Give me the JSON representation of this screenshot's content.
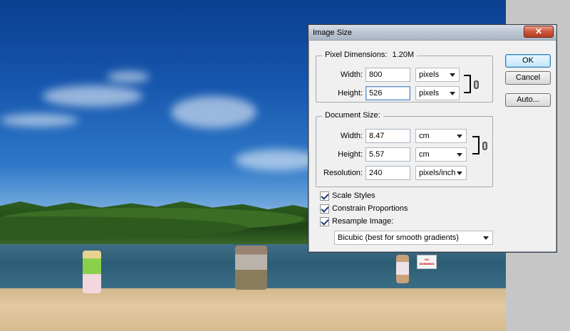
{
  "dialog": {
    "title": "Image Size",
    "close_glyph": "✕",
    "pixel_dimensions": {
      "label": "Pixel Dimensions:",
      "size": "1.20M",
      "width_label": "Width:",
      "width_value": "800",
      "width_unit": "pixels",
      "height_label": "Height:",
      "height_value": "526",
      "height_unit": "pixels"
    },
    "document_size": {
      "label": "Document Size:",
      "width_label": "Width:",
      "width_value": "8.47",
      "width_unit": "cm",
      "height_label": "Height:",
      "height_value": "5.57",
      "height_unit": "cm",
      "resolution_label": "Resolution:",
      "resolution_value": "240",
      "resolution_unit": "pixels/inch"
    },
    "options": {
      "scale_styles": "Scale Styles",
      "constrain_proportions": "Constrain Proportions",
      "resample_image": "Resample Image:",
      "resample_method": "Bicubic (best for smooth gradients)"
    },
    "buttons": {
      "ok": "OK",
      "cancel": "Cancel",
      "auto": "Auto..."
    }
  },
  "background": {
    "sign_text": "NO SWIMMING"
  }
}
